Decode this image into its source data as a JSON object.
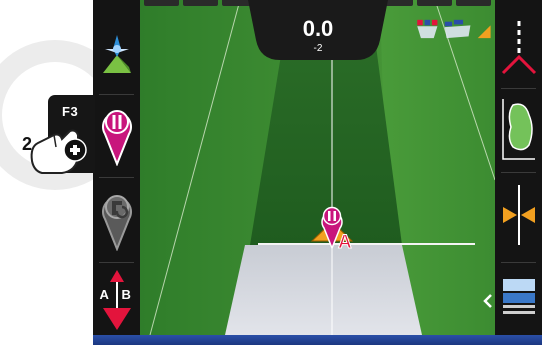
{
  "guidance": {
    "offset_value": "0.0",
    "offset_sub": "-2"
  },
  "marker": {
    "label": "A"
  },
  "left_toolbar": {
    "ab_label_a": "A",
    "ab_label_b": "B"
  },
  "callout": {
    "key": "F3",
    "step_number": "2"
  },
  "status_segments": [
    false,
    false,
    false,
    false,
    true,
    false,
    false,
    false,
    false
  ],
  "colors": {
    "marker_magenta": "#c8157c",
    "ab_red": "#e3143c",
    "active_segment": "#8fd800",
    "bottom_band": "#2b4fa8"
  },
  "icons": {
    "left": [
      "gps-satellite-icon",
      "pause-pin-icon",
      "pin-icon",
      "ab-line-icon"
    ],
    "right": [
      "guidance-line-icon",
      "field-boundary-icon",
      "shift-line-icon",
      "sections-icon",
      "collapse-chevron-icon"
    ]
  }
}
